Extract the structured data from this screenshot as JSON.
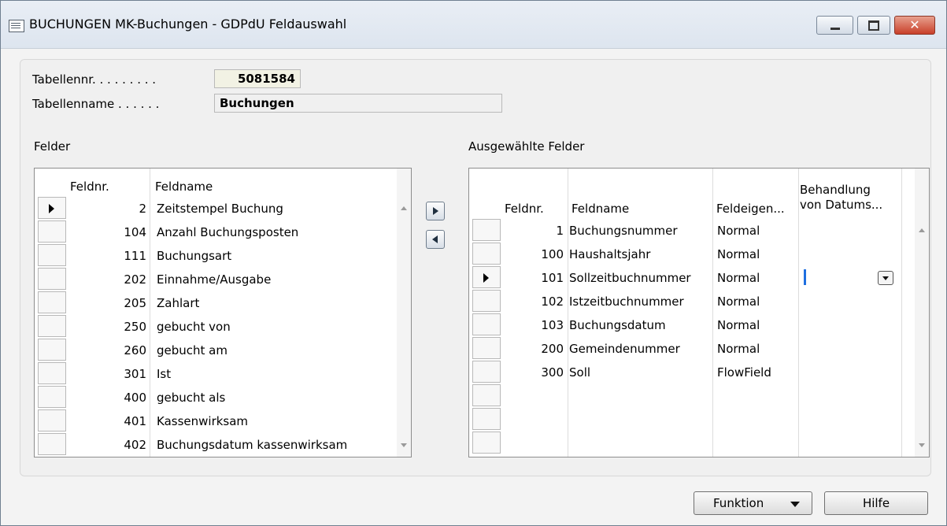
{
  "window": {
    "title": "BUCHUNGEN MK-Buchungen - GDPdU Feldauswahl"
  },
  "header": {
    "tabellennr_label": "Tabellennr. . . . . . . . .",
    "tabellennr_value": "5081584",
    "tabellenname_label": "Tabellenname . . . . . .",
    "tabellenname_value": "Buchungen"
  },
  "felder": {
    "label": "Felder",
    "columns": {
      "feldnr": "Feldnr.",
      "feldname": "Feldname"
    },
    "rows": [
      {
        "nr": "2",
        "name": "Zeitstempel Buchung"
      },
      {
        "nr": "104",
        "name": "Anzahl Buchungsposten"
      },
      {
        "nr": "111",
        "name": "Buchungsart"
      },
      {
        "nr": "202",
        "name": "Einnahme/Ausgabe"
      },
      {
        "nr": "205",
        "name": "Zahlart"
      },
      {
        "nr": "250",
        "name": "gebucht von"
      },
      {
        "nr": "260",
        "name": "gebucht am"
      },
      {
        "nr": "301",
        "name": "Ist"
      },
      {
        "nr": "400",
        "name": "gebucht als"
      },
      {
        "nr": "401",
        "name": "Kassenwirksam"
      },
      {
        "nr": "402",
        "name": "Buchungsdatum kassenwirksam"
      }
    ]
  },
  "ausgewaehlt": {
    "label": "Ausgewählte Felder",
    "columns": {
      "feldnr": "Feldnr.",
      "feldname": "Feldname",
      "feldeigen": "Feldeigen...",
      "behandlung_1": "Behandlung",
      "behandlung_2": "von Datums..."
    },
    "rows": [
      {
        "nr": "1",
        "name": "Buchungsnummer",
        "eig": "Normal"
      },
      {
        "nr": "100",
        "name": "Haushaltsjahr",
        "eig": "Normal"
      },
      {
        "nr": "101",
        "name": "Sollzeitbuchnummer",
        "eig": "Normal"
      },
      {
        "nr": "102",
        "name": "Istzeitbuchnummer",
        "eig": "Normal"
      },
      {
        "nr": "103",
        "name": "Buchungsdatum",
        "eig": "Normal"
      },
      {
        "nr": "200",
        "name": "Gemeindenummer",
        "eig": "Normal"
      },
      {
        "nr": "300",
        "name": "Soll",
        "eig": "FlowField"
      }
    ]
  },
  "buttons": {
    "funktion": "Funktion",
    "hilfe": "Hilfe"
  }
}
